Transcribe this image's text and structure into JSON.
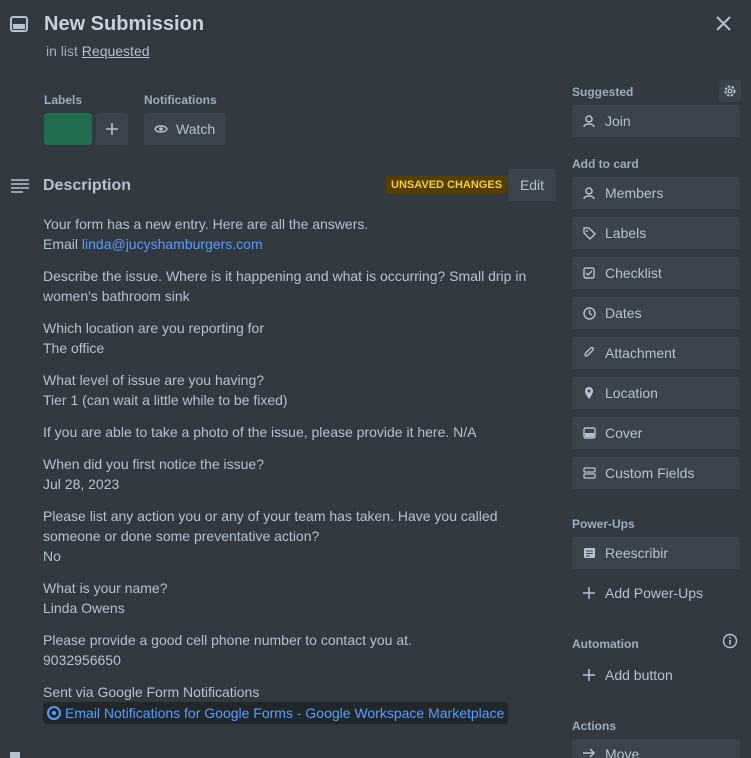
{
  "header": {
    "title": "New Submission",
    "in_list_prefix": "in list",
    "list_name": "Requested"
  },
  "labels": {
    "heading": "Labels",
    "label_color": "#216e4e"
  },
  "notifications": {
    "heading": "Notifications",
    "watch_label": "Watch"
  },
  "description": {
    "heading": "Description",
    "unsaved_badge": "UNSAVED CHANGES",
    "edit_label": "Edit",
    "intro": "Your form has a new entry. Here are all the answers.",
    "email_label": "Email",
    "email": "linda@jucyshamburgers.com",
    "q1": "Describe the issue. Where is it happening and what is occurring? Small drip in women's bathroom sink",
    "q2": "Which location are you reporting for",
    "a2": "The office",
    "q3": "What level of issue are you having?",
    "a3": "Tier 1 (can wait a little while to be fixed)",
    "q4": "If you are able to take a photo of the issue, please provide it here. N/A",
    "q5": "When did you first notice the issue?",
    "a5": "Jul 28, 2023",
    "q6": "Please list any action you or any of your team has taken. Have you called someone or done some preventative action?",
    "a6": "No",
    "q7": "What is your name?",
    "a7": "Linda Owens",
    "q8": "Please provide a good cell phone number to contact you at.",
    "a8": "9032956650",
    "footer": "Sent via Google Form Notifications",
    "link": "Email Notifications for Google Forms - Google Workspace Marketplace"
  },
  "sidebar": {
    "suggested_heading": "Suggested",
    "join": "Join",
    "add_to_card_heading": "Add to card",
    "members": "Members",
    "labels": "Labels",
    "checklist": "Checklist",
    "dates": "Dates",
    "attachment": "Attachment",
    "location": "Location",
    "cover": "Cover",
    "custom_fields": "Custom Fields",
    "powerups_heading": "Power-Ups",
    "reescribir": "Reescribir",
    "add_powerups": "Add Power-Ups",
    "automation_heading": "Automation",
    "add_button": "Add button",
    "actions_heading": "Actions",
    "move": "Move"
  },
  "colors": {
    "background": "#323940",
    "button": "#3b444c",
    "link": "#579dff",
    "badge_bg": "#533f04",
    "badge_text": "#f5cd47"
  }
}
